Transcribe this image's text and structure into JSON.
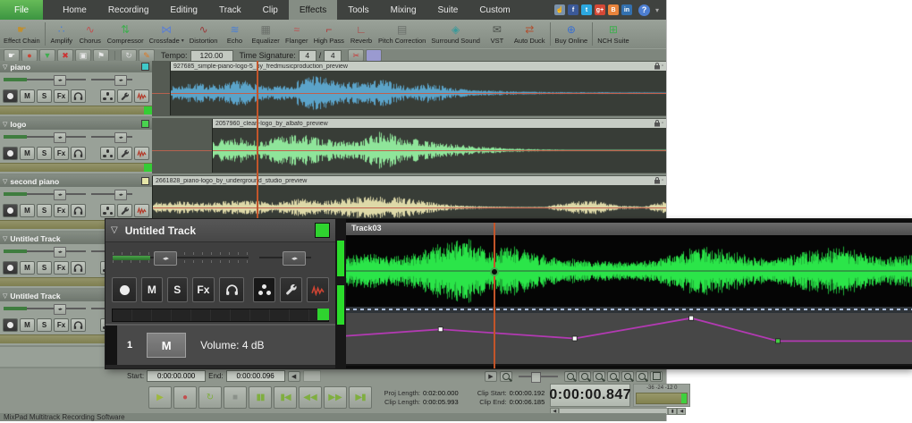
{
  "window": {
    "status_text": "MixPad Multitrack Recording Software"
  },
  "menu": {
    "tabs": [
      "File",
      "Home",
      "Recording",
      "Editing",
      "Track",
      "Clip",
      "Effects",
      "Tools",
      "Mixing",
      "Suite",
      "Custom"
    ],
    "active_tab": "Effects",
    "help_label": "?"
  },
  "social_icons": [
    "thumbs-up",
    "facebook",
    "twitter",
    "google-plus",
    "blogger",
    "linkedin"
  ],
  "ribbon": {
    "buttons": [
      {
        "label": "Effect Chain",
        "icon": "effect-chain",
        "group_end": true
      },
      {
        "label": "Amplify",
        "icon": "amplify"
      },
      {
        "label": "Chorus",
        "icon": "chorus"
      },
      {
        "label": "Compressor",
        "icon": "compressor"
      },
      {
        "label": "Crossfade",
        "icon": "crossfade",
        "caret": true
      },
      {
        "label": "Distortion",
        "icon": "distortion"
      },
      {
        "label": "Echo",
        "icon": "echo"
      },
      {
        "label": "Equalizer",
        "icon": "equalizer"
      },
      {
        "label": "Flanger",
        "icon": "flanger"
      },
      {
        "label": "High Pass",
        "icon": "high-pass"
      },
      {
        "label": "Reverb",
        "icon": "reverb"
      },
      {
        "label": "Pitch Correction",
        "icon": "pitch-correction"
      },
      {
        "label": "Surround Sound",
        "icon": "surround-sound"
      },
      {
        "label": "VST",
        "icon": "vst"
      },
      {
        "label": "Auto Duck",
        "icon": "auto-duck",
        "group_end": true
      },
      {
        "label": "Buy Online",
        "icon": "buy-online",
        "group_end": true
      },
      {
        "label": "NCH Suite",
        "icon": "nch-suite"
      }
    ]
  },
  "toolbar": {
    "tools_left": [
      "select-tool",
      "record-enable",
      "import-file",
      "remove-clip",
      "monitor",
      "flag"
    ],
    "tools_mid": [
      "loop",
      "pencil"
    ],
    "tempo_label": "Tempo:",
    "tempo_value": "120.00",
    "timesig_label": "Time Signature:",
    "timesig_num": "4",
    "timesig_sep": "/",
    "timesig_den": "4",
    "tools_right": [
      "split",
      "swatch"
    ]
  },
  "track_buttons": {
    "mute": "M",
    "solo": "S",
    "fx": "Fx"
  },
  "tracks": [
    {
      "name": "piano",
      "color": "#3fc9c9"
    },
    {
      "name": "logo",
      "color": "#49d24f"
    },
    {
      "name": "second piano",
      "color": "#e6e6a8"
    },
    {
      "name": "Untitled Track",
      "color": "#bfe68f"
    },
    {
      "name": "Untitled Track",
      "color": "#bfe68f"
    }
  ],
  "clips": [
    {
      "title": "927685_simple-piano-logo-5_by_fredmusicproduction_preview",
      "start": 20,
      "color": "#5ba3c9",
      "envelope": [
        0.3,
        0.45,
        0.38,
        0.6,
        0.28,
        0.36,
        0.88,
        0.52,
        0.48,
        0.62,
        0.3,
        0.45,
        0.22,
        0.14,
        0.1,
        0.07,
        0.05,
        0.04,
        0.04,
        0.03,
        0.03,
        0.02
      ]
    },
    {
      "title": "2057960_clean-logo_by_albafo_preview",
      "start": 67,
      "color": "#8fe59a",
      "envelope": [
        0.5,
        0.62,
        0.38,
        0.72,
        0.68,
        0.45,
        0.4,
        0.85,
        0.62,
        0.4,
        0.28,
        0.18,
        0.12,
        0.07,
        0.04,
        0.02,
        0.01,
        0.01,
        0.0,
        0.0
      ]
    },
    {
      "title": "2661828_piano-logo_by_underground_studio_preview",
      "start": 0,
      "color": "#ded9a8",
      "envelope": [
        0.22,
        0.28,
        0.22,
        0.3,
        0.33,
        0.22,
        0.4,
        0.28,
        0.45,
        0.52,
        0.48,
        0.3,
        0.14,
        0.07,
        0.04,
        0.03,
        0.03,
        0.25,
        0.33,
        0.1,
        0.05,
        0.28
      ]
    }
  ],
  "inspector": {
    "title": "Untitled Track",
    "row_number": "1",
    "volume_text": "Volume: 4 dB"
  },
  "wave_view": {
    "track_label": "Track03",
    "waveform_color": "#2be549",
    "envelope": [
      0.45,
      0.55,
      0.42,
      0.5,
      0.8,
      0.95,
      0.65,
      0.72,
      0.5,
      0.42,
      0.32,
      0.28,
      0.25,
      0.33,
      0.52,
      0.72,
      0.62,
      0.45,
      0.35,
      0.48,
      0.62,
      0.7,
      0.52,
      0.4,
      0.45
    ],
    "automation": {
      "points": [
        [
          0,
          45
        ],
        [
          16.7,
          32
        ],
        [
          40.4,
          50
        ],
        [
          61,
          10
        ],
        [
          76.3,
          55
        ],
        [
          100,
          55
        ]
      ],
      "markers": [
        {
          "index": 1,
          "color": "#ffffff"
        },
        {
          "index": 2,
          "color": "#ffffff"
        },
        {
          "index": 3,
          "color": "#ffffff"
        },
        {
          "index": 4,
          "color": "#44cc44"
        }
      ],
      "line_color": "#b23ab2"
    }
  },
  "range_bar": {
    "start_label": "Start:",
    "start_value": "0:00:00.000",
    "end_label": "End:",
    "end_value": "0:00:00.096"
  },
  "zoom_buttons": [
    "zoom-in",
    "zoom-out",
    "zoom-to-selection",
    "zoom-vertical-in",
    "zoom-vertical-out",
    "zoom-full",
    "zoom-fit"
  ],
  "transport_buttons": [
    "play",
    "record",
    "loop",
    "stop",
    "pause",
    "skip-to-start",
    "rewind",
    "fast-forward",
    "skip-to-end"
  ],
  "info": {
    "proj_length_label": "Proj Length:",
    "proj_length": "0:02:00.000",
    "clip_length_label": "Clip Length:",
    "clip_length": "0:00:05.993",
    "clip_start_label": "Clip Start:",
    "clip_start": "0:00:00.192",
    "clip_end_label": "Clip End:",
    "clip_end": "0:00:06.185"
  },
  "time_display": "0:00:00.847",
  "meter": {
    "scale": "-36 -24 -12  0"
  }
}
